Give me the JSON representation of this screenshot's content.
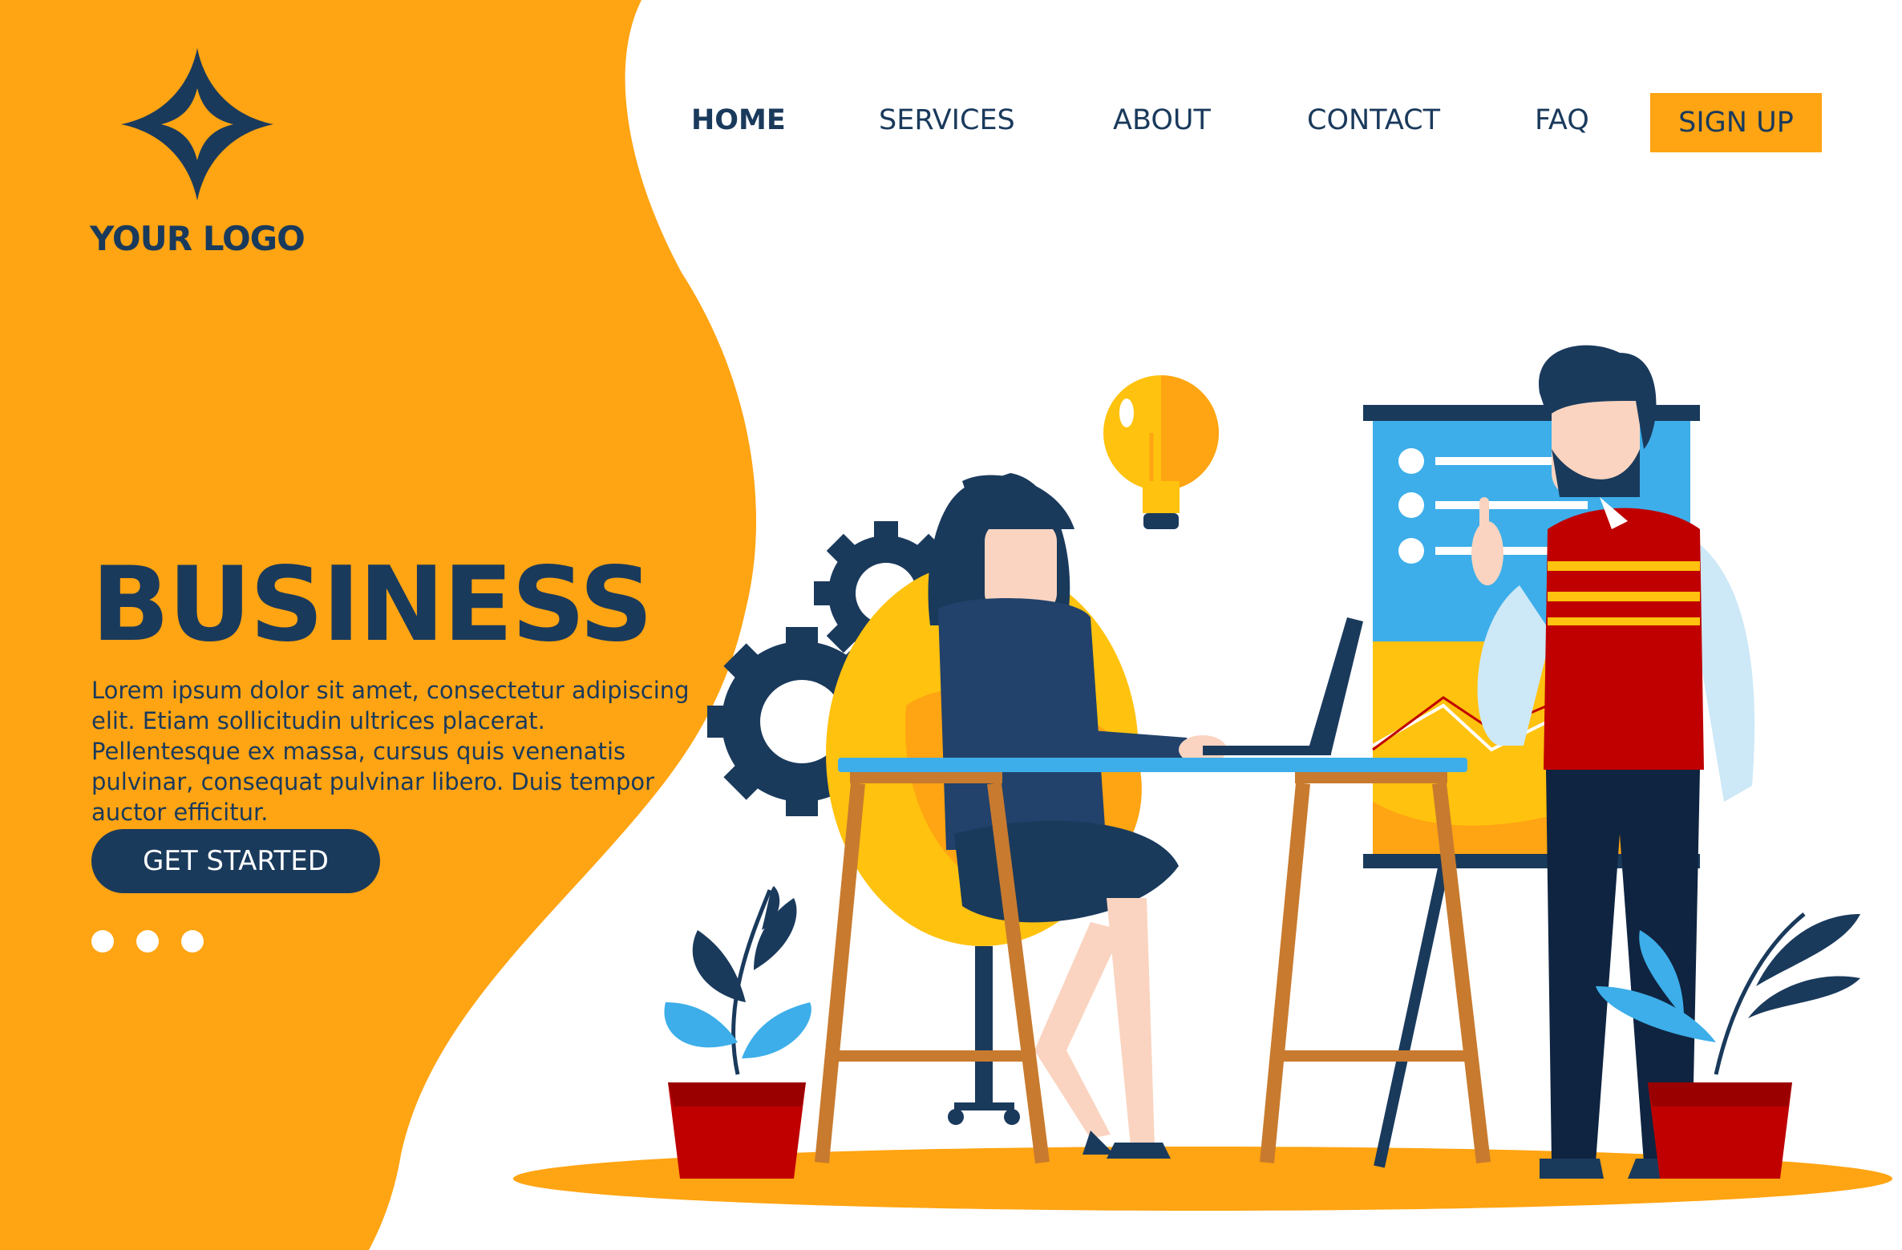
{
  "brand": {
    "logo_text": "YOUR LOGO",
    "logo_icon": "four-point-star-icon",
    "accent_color": "#ffa412",
    "primary_color": "#1a3a5c"
  },
  "nav": {
    "items": [
      {
        "label": "HOME",
        "active": true
      },
      {
        "label": "SERVICES",
        "active": false
      },
      {
        "label": "ABOUT",
        "active": false
      },
      {
        "label": "CONTACT",
        "active": false
      },
      {
        "label": "FAQ",
        "active": false
      }
    ],
    "signup_label": "SIGN UP"
  },
  "hero": {
    "title": "BUSINESS",
    "body": "Lorem ipsum dolor sit amet, consectetur adipiscing elit. Etiam sollicitudin ultrices placerat. Pellentesque ex massa, cursus quis venenatis pulvinar, consequat pulvinar libero. Duis tempor auctor efficitur.",
    "cta_label": "GET STARTED",
    "carousel_dots": 3
  },
  "illustration": {
    "icons": [
      "gear-icon",
      "lightbulb-icon",
      "presentation-board-icon",
      "laptop-icon",
      "plant-icon"
    ]
  }
}
